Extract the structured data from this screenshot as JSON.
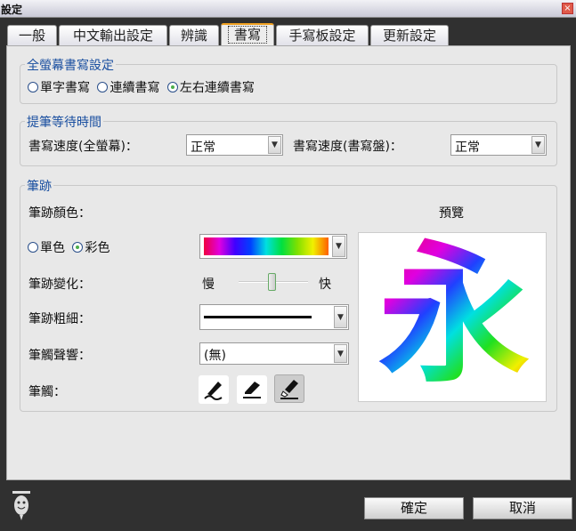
{
  "window": {
    "title": "設定",
    "close": "×"
  },
  "tabs": [
    "一般",
    "中文輸出設定",
    "辨識",
    "書寫",
    "手寫板設定",
    "更新設定"
  ],
  "fullscreen": {
    "label": "全螢幕書寫設定",
    "options": [
      "單字書寫",
      "連續書寫",
      "左右連續書寫"
    ],
    "selected": 2
  },
  "wait": {
    "label": "提筆等待時間",
    "speed_full_label": "書寫速度(全螢幕)：",
    "speed_full_value": "正常",
    "speed_pad_label": "書寫速度(書寫盤)：",
    "speed_pad_value": "正常"
  },
  "stroke": {
    "label": "筆跡",
    "color_label": "筆跡顏色：",
    "mono": "單色",
    "multi": "彩色",
    "variation_label": "筆跡變化：",
    "slow": "慢",
    "fast": "快",
    "slider_value": 0.5,
    "width_label": "筆跡粗細：",
    "sound_label": "筆觸聲響：",
    "sound_value": "(無)",
    "brush_label": "筆觸：",
    "preview_label": "預覽",
    "preview_char": "永"
  },
  "buttons": {
    "ok": "確定",
    "cancel": "取消"
  }
}
